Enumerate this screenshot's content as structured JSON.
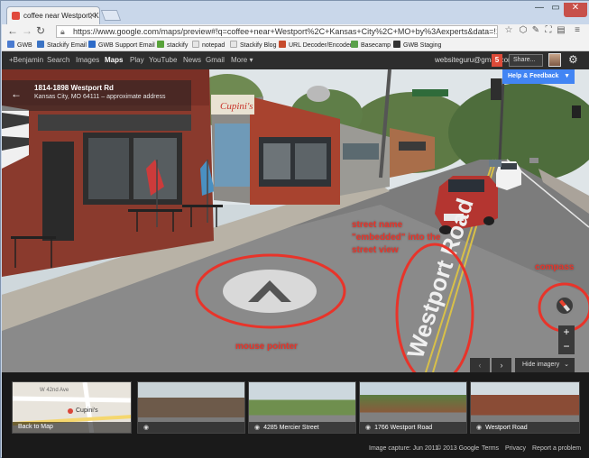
{
  "browser": {
    "tab_title": "coffee near Westport, Kan",
    "url": "https://www.google.com/maps/preview#!q=coffee+near+Westport%2C+Kansas+City%2C+MO+by%3Aexperts&data=!1m8!1m3!1d3!",
    "bookmarks": [
      {
        "label": "GWB",
        "color": "#4a7bd0"
      },
      {
        "label": "Stackify Email",
        "color": "#3b73c4"
      },
      {
        "label": "GWB Support Email",
        "color": "#2d6bc8"
      },
      {
        "label": "stackify",
        "color": "#58a33a"
      },
      {
        "label": "notepad",
        "color": "#cccccc"
      },
      {
        "label": "Stackify Blog",
        "color": "#bbbbbb"
      },
      {
        "label": "URL Decoder/Encoder",
        "color": "#c74b2c"
      },
      {
        "label": "Basecamp",
        "color": "#5aa14a"
      },
      {
        "label": "GWB Staging",
        "color": "#333333"
      }
    ]
  },
  "google_bar": {
    "items": [
      {
        "label": "+Benjamin",
        "active": false
      },
      {
        "label": "Search",
        "active": false
      },
      {
        "label": "Images",
        "active": false
      },
      {
        "label": "Maps",
        "active": true
      },
      {
        "label": "Play",
        "active": false
      },
      {
        "label": "YouTube",
        "active": false
      },
      {
        "label": "News",
        "active": false
      },
      {
        "label": "Gmail",
        "active": false
      },
      {
        "label": "More ▾",
        "active": false
      }
    ],
    "email": "websiteguru@gmail.com",
    "notifications": "5",
    "share_label": "Share...",
    "accent": "#dd4b39"
  },
  "streetview": {
    "address_title": "1814-1898 Westport Rd",
    "address_sub": "Kansas City, MO 64111 – approximate address",
    "help_label": "Help & Feedback",
    "storefront_sign": "Cupini's",
    "street_text": "Westport Road",
    "hide_imagery": "Hide imagery",
    "annotations": {
      "street_name": "street name",
      "embedded": "\"embedded\" into the",
      "street_view": "street view",
      "compass": "compass",
      "mouse_pointer": "mouse pointer"
    },
    "annotation_color": "#e8342a"
  },
  "filmstrip": {
    "items": [
      {
        "label": "Back to Map",
        "map_label": "Cupini's",
        "road_label": "W 42nd Ave"
      },
      {
        "label": ""
      },
      {
        "label": "4285 Mercier Street"
      },
      {
        "label": "1766 Westport Road"
      },
      {
        "label": "Westport Road"
      }
    ]
  },
  "footer": {
    "capture": "Image capture: Jun 2011",
    "copyright": "© 2013 Google",
    "terms": "Terms",
    "privacy": "Privacy",
    "report": "Report a problem"
  }
}
